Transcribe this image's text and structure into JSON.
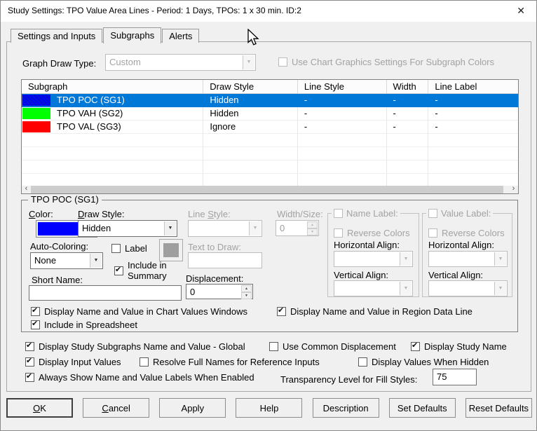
{
  "window": {
    "title": "Study Settings: TPO Value Area Lines - Period: 1 Days, TPOs: 1 x 30 min. ID:2"
  },
  "icons": {
    "close": "✕",
    "dropdown": "▼",
    "spin_up": "▲",
    "spin_down": "▼",
    "scroll_left": "‹",
    "scroll_right": "›"
  },
  "tabs": [
    {
      "label": "Settings and Inputs"
    },
    {
      "label": "Subgraphs"
    },
    {
      "label": "Alerts"
    }
  ],
  "graph_draw_type": {
    "label": "Graph Draw Type:",
    "value": "Custom",
    "use_chart_graphics_label": "Use Chart Graphics Settings For Subgraph Colors"
  },
  "subgraph_table": {
    "columns": [
      "Subgraph",
      "Draw Style",
      "Line Style",
      "Width",
      "Line Label"
    ],
    "rows": [
      {
        "name": "TPO POC (SG1)",
        "color": "#0000ff",
        "draw_style": "Hidden",
        "line_style": "-",
        "width": "-",
        "line_label": "-",
        "selected": true
      },
      {
        "name": "TPO VAH (SG2)",
        "color": "#00ff00",
        "draw_style": "Hidden",
        "line_style": "-",
        "width": "-",
        "line_label": "-",
        "selected": false
      },
      {
        "name": "TPO VAL (SG3)",
        "color": "#ff0000",
        "draw_style": "Ignore",
        "line_style": "-",
        "width": "-",
        "line_label": "-",
        "selected": false
      }
    ]
  },
  "group": {
    "title": "TPO POC (SG1)",
    "color_label": {
      "pre": "",
      "u": "C",
      "rest": "olor:"
    },
    "color_value": "#0000ff",
    "draw_style_label": {
      "pre": "",
      "u": "D",
      "rest": "raw Style:"
    },
    "draw_style_value": "Hidden",
    "line_style_label": {
      "pre": "Line ",
      "u": "S",
      "rest": "tyle:"
    },
    "line_style_value": "",
    "width_size_label": "Width/Size:",
    "width_size_value": "0",
    "auto_coloring_label": "Auto-Coloring:",
    "auto_coloring_value": "None",
    "label_checkbox_label": "Label",
    "label_swatch_color": "#9f9f9f",
    "include_in_summary_label": "Include in Summary",
    "text_to_draw_label": "Text to Draw:",
    "text_to_draw_value": "",
    "short_name_label": "Short Name:",
    "short_name_value": "",
    "displacement_label": "Displacement:",
    "displacement_value": "0",
    "name_label_group": {
      "title": "Name Label:",
      "reverse_label": "Reverse Colors",
      "horizontal_label": "Horizontal Align:",
      "vertical_label": "Vertical Align:"
    },
    "value_label_group": {
      "title": "Value Label:",
      "reverse_label": "Reverse Colors",
      "horizontal_label": "Horizontal Align:",
      "vertical_label": "Vertical Align:"
    },
    "checks": [
      {
        "label": "Display Name and Value in Chart Values Windows",
        "checked": true
      },
      {
        "label": "Display Name and Value in Region Data Line",
        "checked": true
      },
      {
        "label": "Include in Spreadsheet",
        "checked": true
      }
    ]
  },
  "global_checks": [
    {
      "label": "Display Study Subgraphs Name and Value - Global",
      "checked": true
    },
    {
      "label": "Use Common Displacement",
      "checked": false
    },
    {
      "label": "Display Study Name",
      "checked": true
    },
    {
      "label": "Display Input Values",
      "checked": true
    },
    {
      "label": "Resolve Full Names for Reference Inputs",
      "checked": false
    },
    {
      "label": "Display Values When Hidden",
      "checked": false
    },
    {
      "label": "Always Show Name and Value Labels When Enabled",
      "checked": true
    }
  ],
  "transparency": {
    "label": "Transparency Level for Fill Styles:",
    "value": "75"
  },
  "buttons": [
    {
      "pre": "",
      "u": "O",
      "rest": "K"
    },
    {
      "pre": "",
      "u": "C",
      "rest": "ancel"
    },
    {
      "pre": "Apply",
      "u": "",
      "rest": ""
    },
    {
      "pre": "Help",
      "u": "",
      "rest": ""
    },
    {
      "pre": "Description",
      "u": "",
      "rest": ""
    },
    {
      "pre": "Set Defaults",
      "u": "",
      "rest": ""
    },
    {
      "pre": "Reset Defaults",
      "u": "",
      "rest": ""
    }
  ],
  "colors": {
    "selection": "#0078d7",
    "dialog_bg": "#f0f0f0",
    "titlebar_bg": "#ffffff"
  }
}
